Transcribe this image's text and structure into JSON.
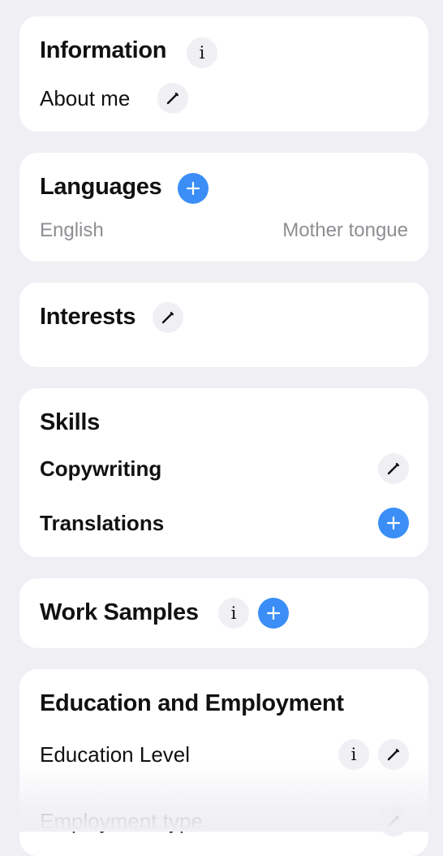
{
  "information": {
    "title": "Information",
    "about_label": "About me",
    "info_glyph": "i"
  },
  "languages": {
    "title": "Languages",
    "items": [
      {
        "language": "English",
        "level": "Mother tongue"
      }
    ]
  },
  "interests": {
    "title": "Interests"
  },
  "skills": {
    "title": "Skills",
    "items": [
      {
        "label": "Copywriting"
      },
      {
        "label": "Translations"
      }
    ]
  },
  "work_samples": {
    "title": "Work Samples",
    "info_glyph": "i"
  },
  "education": {
    "title": "Education and Employment",
    "education_level_label": "Education Level",
    "employment_type_label": "Employment type",
    "info_glyph": "i"
  },
  "colors": {
    "background": "#efeff4",
    "card": "#ffffff",
    "accent_blue": "#3a8ef6",
    "muted_text": "#8e8e93"
  }
}
